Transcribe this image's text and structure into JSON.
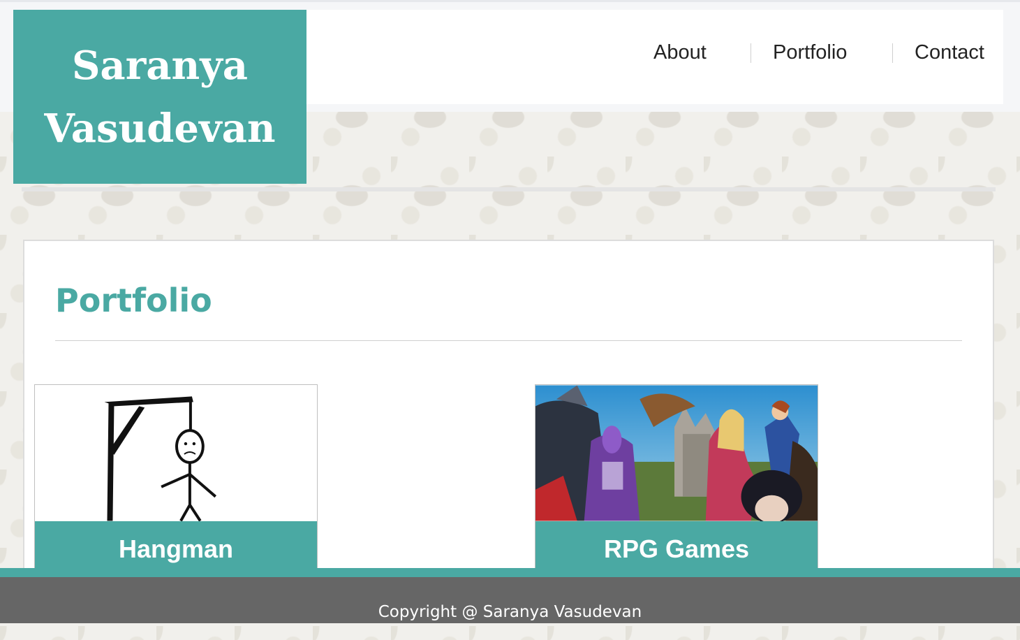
{
  "brand": {
    "line1": "Saranya",
    "line2": "Vasudevan"
  },
  "nav": [
    {
      "label": "About"
    },
    {
      "label": "Portfolio"
    },
    {
      "label": "Contact"
    }
  ],
  "portfolio": {
    "title": "Portfolio",
    "cards": [
      {
        "label": "Hangman",
        "image_icon": "hangman-drawing"
      },
      {
        "label": "RPG Games",
        "image_icon": "rpg-collage"
      }
    ]
  },
  "footer": {
    "copyright": "Copyright @ Saranya Vasudevan"
  },
  "colors": {
    "accent": "#4aa9a3",
    "footer": "#666666"
  }
}
